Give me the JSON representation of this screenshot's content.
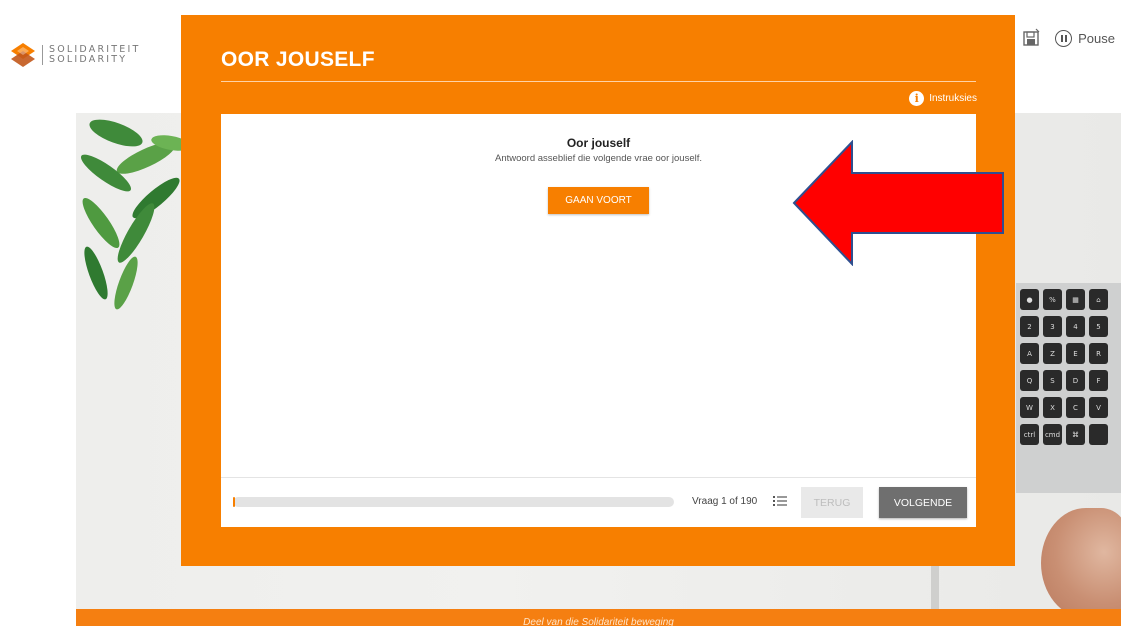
{
  "brand": {
    "line1": "SOLIDARITEIT",
    "line2": "SOLIDARITY"
  },
  "toolbar": {
    "save_icon": "save-icon",
    "pause_label": "Pouse"
  },
  "panel": {
    "title": "OOR JOUSELF",
    "instructions_label": "Instruksies"
  },
  "card": {
    "title": "Oor jouself",
    "subtitle": "Antwoord asseblief die volgende vrae oor jouself.",
    "continue_label": "GAAN VOORT"
  },
  "navigation": {
    "question_counter": "Vraag 1 of 190",
    "progress": 0.005,
    "back_label": "TERUG",
    "next_label": "VOLGENDE"
  },
  "footer": {
    "text": "Deel van die Solidariteit beweging"
  },
  "colors": {
    "accent": "#f77f00",
    "annotation_arrow": "#ff0000"
  },
  "keyboard_keys": [
    [
      "●",
      "%",
      "▦",
      "⌂"
    ],
    [
      "2",
      "3",
      "4",
      "5"
    ],
    [
      "A",
      "Z",
      "E",
      "R"
    ],
    [
      "Q",
      "S",
      "D",
      "F"
    ],
    [
      "W",
      "X",
      "C",
      "V"
    ],
    [
      "ctrl",
      "cmd",
      "⌘",
      ""
    ]
  ]
}
